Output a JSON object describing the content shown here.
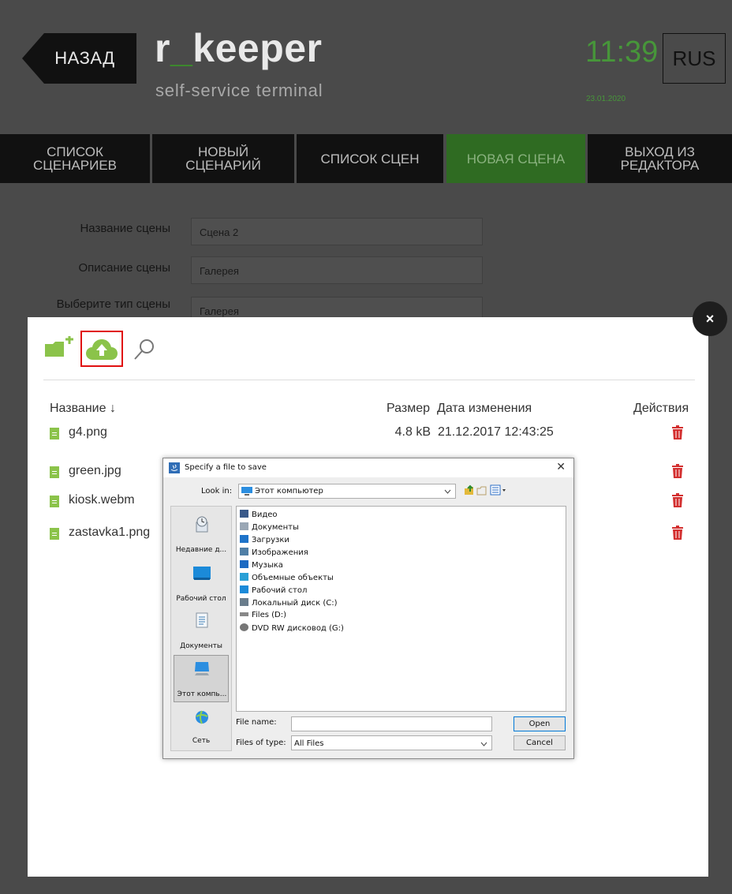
{
  "header": {
    "back_label": "НАЗАД",
    "logo_left": "r",
    "logo_underscore": "_",
    "logo_right": "keeper",
    "subtitle": "self-service terminal",
    "time": "11:39",
    "date": "23.01.2020",
    "language": "RUS"
  },
  "nav": {
    "items": [
      {
        "label": "СПИСОК\nСЦЕНАРИЕВ"
      },
      {
        "label": "НОВЫЙ\nСЦЕНАРИЙ"
      },
      {
        "label": "СПИСОК СЦЕН"
      },
      {
        "label": "НОВАЯ СЦЕНА"
      },
      {
        "label": "ВЫХОД ИЗ\nРЕДАКТОРА"
      }
    ],
    "active": "НОВАЯ СЦЕНА"
  },
  "form": {
    "name_label": "Название сцены",
    "name_value": "Сцена 2",
    "description_label": "Описание сцены",
    "description_value": "Галерея",
    "type_label": "Выберите тип сцены",
    "type_value": "Галерея"
  },
  "file_manager": {
    "close_label": "×",
    "columns": {
      "name": "Название ↓",
      "size": "Размер",
      "date": "Дата изменения",
      "actions": "Действия"
    },
    "files": [
      {
        "name": "g4.png",
        "size": "4.8 kB",
        "date": "21.12.2017 12:43:25"
      },
      {
        "name": "green.jpg",
        "size": "",
        "date": ""
      },
      {
        "name": "kiosk.webm",
        "size": "",
        "date": ""
      },
      {
        "name": "zastavka1.png",
        "size": "",
        "date": ""
      }
    ],
    "colors": {
      "folder": "#8bc34a",
      "upload": "#8bc34a",
      "trash": "#d32f2f",
      "highlight": "#e01010"
    }
  },
  "dialog": {
    "title": "Specify a file to save",
    "close": "✕",
    "look_in_label": "Look in:",
    "look_in_value": "Этот компьютер",
    "places": [
      {
        "label": "Недавние д..."
      },
      {
        "label": "Рабочий стол"
      },
      {
        "label": "Документы"
      },
      {
        "label": "Этот компь..."
      },
      {
        "label": "Сеть"
      }
    ],
    "list": [
      {
        "label": "Видео",
        "icon": "video-folder-icon",
        "color": "#3a5a8a"
      },
      {
        "label": "Документы",
        "icon": "documents-folder-icon",
        "color": "#9aa7b5"
      },
      {
        "label": "Загрузки",
        "icon": "downloads-folder-icon",
        "color": "#1e73c9"
      },
      {
        "label": "Изображения",
        "icon": "pictures-folder-icon",
        "color": "#4f7ea6"
      },
      {
        "label": "Музыка",
        "icon": "music-folder-icon",
        "color": "#1c6ac2"
      },
      {
        "label": "Объемные объекты",
        "icon": "3d-objects-folder-icon",
        "color": "#2aa0d6"
      },
      {
        "label": "Рабочий стол",
        "icon": "desktop-folder-icon",
        "color": "#1b8ad9"
      },
      {
        "label": "Локальный диск (C:)",
        "icon": "local-disk-icon",
        "color": "#6a7d8c"
      },
      {
        "label": "Files (D:)",
        "icon": "drive-icon",
        "color": "#888888"
      },
      {
        "label": "DVD RW дисковод (G:)",
        "icon": "dvd-drive-icon",
        "color": "#777777"
      }
    ],
    "file_name_label": "File name:",
    "file_name_value": "",
    "file_type_label": "Files of type:",
    "file_type_value": "All Files",
    "open_label": "Open",
    "cancel_label": "Cancel"
  }
}
